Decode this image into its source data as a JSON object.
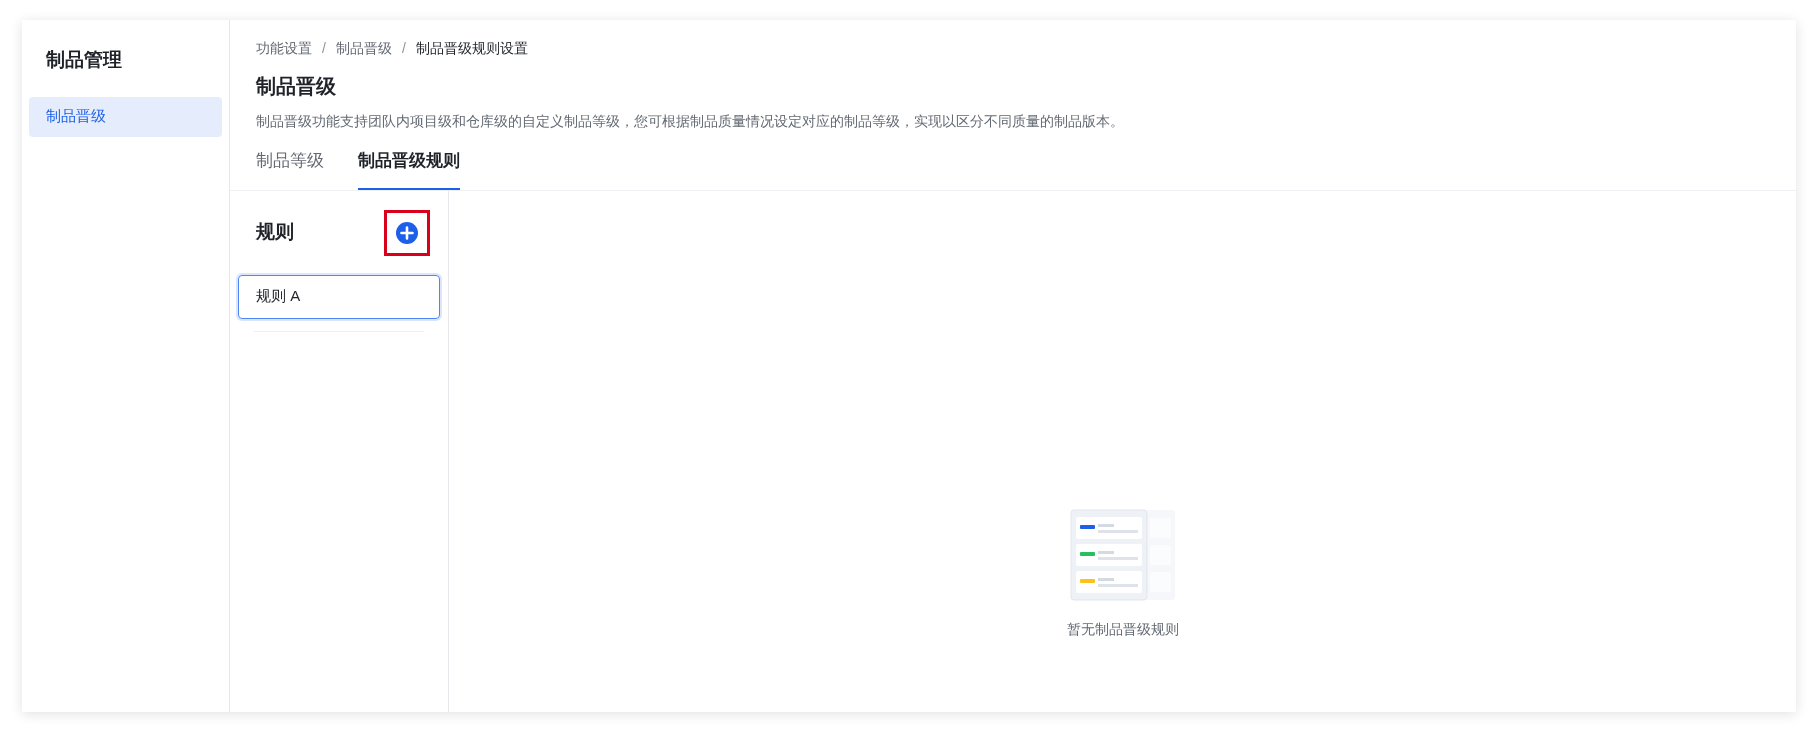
{
  "sidebar": {
    "title": "制品管理",
    "items": [
      {
        "label": "制品晋级",
        "selected": true
      }
    ]
  },
  "breadcrumb": [
    "功能设置",
    "制品晋级",
    "制品晋级规则设置"
  ],
  "breadcrumb_separator": "/",
  "page": {
    "title": "制品晋级",
    "description": "制品晋级功能支持团队内项目级和仓库级的自定义制品等级，您可根据制品质量情况设定对应的制品等级，实现以区分不同质量的制品版本。"
  },
  "tabs": [
    {
      "label": "制品等级",
      "selected": false
    },
    {
      "label": "制品晋级规则",
      "selected": true
    }
  ],
  "rules_panel": {
    "title": "规则",
    "add_button": {
      "highlighted": true
    },
    "rules": [
      {
        "label": "规则 A",
        "selected": true
      }
    ]
  },
  "empty_state": {
    "message": "暂无制品晋级规则"
  }
}
